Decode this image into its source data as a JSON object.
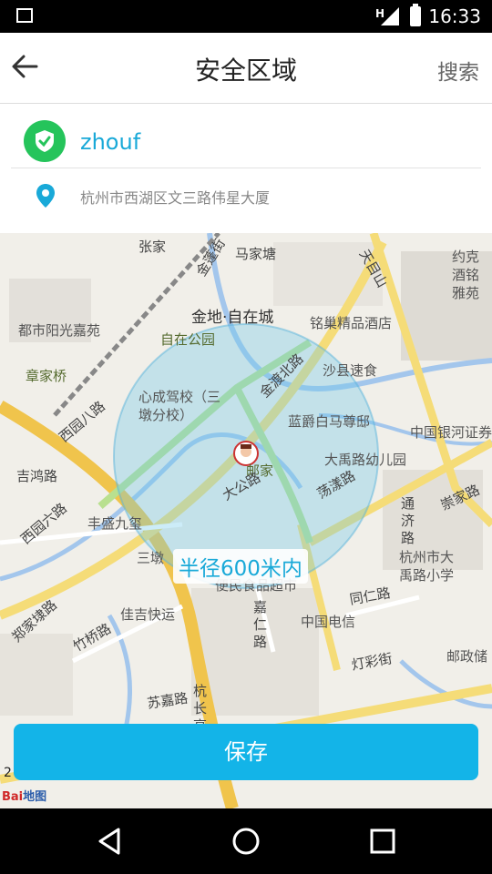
{
  "status_bar": {
    "time": "16:33",
    "network_badge": "H"
  },
  "header": {
    "title": "安全区域",
    "search_label": "搜索"
  },
  "user": {
    "name": "zhouf"
  },
  "location": {
    "address": "杭州市西湖区文三路伟星大厦"
  },
  "map": {
    "radius_label": "半径600米内",
    "scale_text": "2",
    "brand": "Bai",
    "brand_map": "地图",
    "labels": {
      "zhangjia": "张家",
      "majiatang": "马家塘",
      "jinpeng": "金蓬街",
      "yueju": "约克酒铭雅苑",
      "tianmu": "天目山",
      "jindi": "金地·自在城",
      "ducheng": "都市阳光嘉苑",
      "zizai_park": "自在公园",
      "mingchao": "铭巢精品酒店",
      "zhangjiaqiao": "章家桥",
      "xiyuanbalu": "西园八路",
      "xincheng": "心成驾校（三墩分校）",
      "jindu": "金渡北路",
      "shaxian": "沙县速食",
      "lanjue": "蓝爵白马尊邸",
      "zhongguo": "中国银河证券",
      "jihong": "吉鸿路",
      "dayu_kinder": "大禹路幼儿园",
      "youjia": "邮家",
      "dagong": "大公路",
      "dangyang": "荡漾路",
      "xiyuanliu": "西园六路",
      "fengsheng": "丰盛九玺",
      "tongji": "通济路",
      "chongjia": "崇家路",
      "sandun": "三墩",
      "hz_daxue": "杭州市大禹路小学",
      "zhengjiadai": "郑家埭路",
      "bianmin": "便民食品超市",
      "jiajiao": "佳吉快运",
      "jiaren": "嘉仁路",
      "tongren": "同仁路",
      "zhuqiao": "竹桥路",
      "dianxin": "中国电信",
      "dengcai": "灯彩街",
      "youzheng": "邮政储",
      "sujia": "苏嘉路",
      "hangzhang": "杭长高"
    }
  },
  "actions": {
    "save_label": "保存"
  }
}
